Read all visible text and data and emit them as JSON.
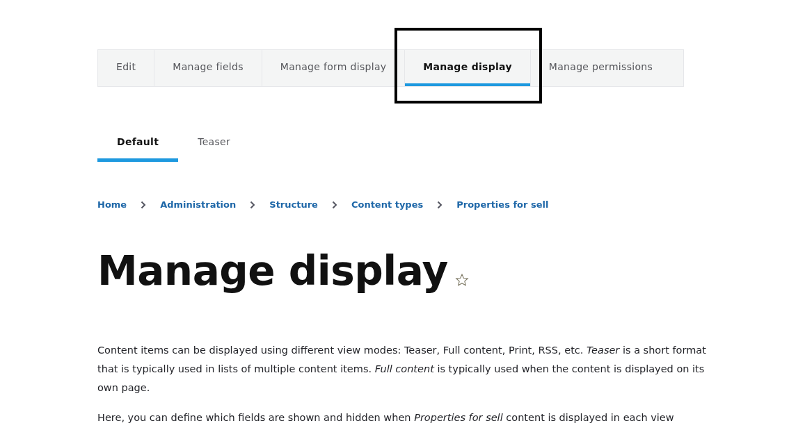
{
  "primary_tabs": [
    {
      "label": "Edit",
      "selected": false,
      "highlighted": false
    },
    {
      "label": "Manage fields",
      "selected": false,
      "highlighted": false
    },
    {
      "label": "Manage form display",
      "selected": false,
      "highlighted": false
    },
    {
      "label": "Manage display",
      "selected": true,
      "highlighted": true
    },
    {
      "label": "Manage permissions",
      "selected": false,
      "highlighted": false
    }
  ],
  "secondary_tabs": [
    {
      "label": "Default",
      "selected": true
    },
    {
      "label": "Teaser",
      "selected": false
    }
  ],
  "breadcrumb": [
    "Home",
    "Administration",
    "Structure",
    "Content types",
    "Properties for sell"
  ],
  "page_title": "Manage display",
  "paragraphs": [
    "Content items can be displayed using different view modes: Teaser, Full content, Print, RSS, etc. *Teaser* is a short format that is typically used in lists of multiple content items. *Full content* is typically used when the content is displayed on its own page.",
    "Here, you can define which fields are shown and hidden when *Properties for sell* content is displayed in each view"
  ]
}
